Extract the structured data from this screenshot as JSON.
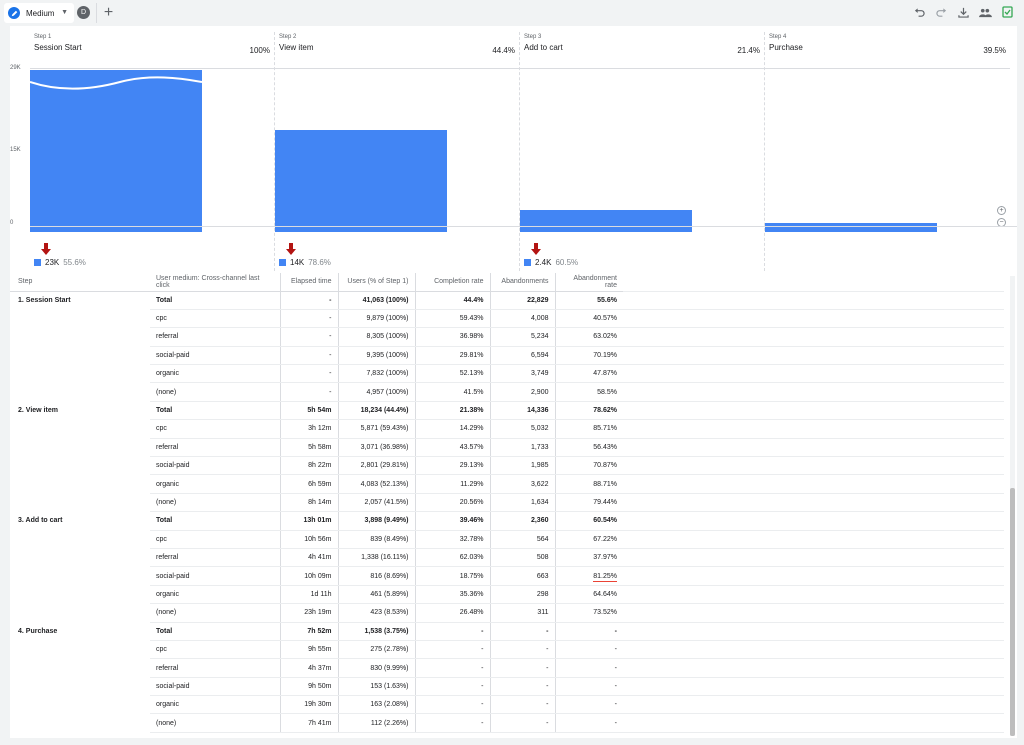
{
  "tab": {
    "label": "Medium",
    "avatar": "D",
    "add": "+"
  },
  "toolbar": {
    "icons": [
      "undo-icon",
      "redo-icon",
      "download-icon",
      "share-users-icon",
      "check-doc-icon"
    ]
  },
  "colors": {
    "bar": "#4285f4",
    "arrow": "#b31412",
    "underline": "#ea4335"
  },
  "funnel": {
    "y_ticks": [
      "29K",
      "15K",
      "0"
    ],
    "steps": [
      {
        "num": "Step 1",
        "name": "Session Start",
        "pct": "100%",
        "value": 41063,
        "abandon_value": "23K",
        "abandon_pct": "55.6%"
      },
      {
        "num": "Step 2",
        "name": "View item",
        "pct": "44.4%",
        "value": 18234,
        "abandon_value": "14K",
        "abandon_pct": "78.6%"
      },
      {
        "num": "Step 3",
        "name": "Add to cart",
        "pct": "21.4%",
        "value": 3898,
        "abandon_value": "2.4K",
        "abandon_pct": "60.5%"
      },
      {
        "num": "Step 4",
        "name": "Purchase",
        "pct": "39.5%",
        "value": 1538,
        "abandon_value": "",
        "abandon_pct": ""
      }
    ]
  },
  "table": {
    "headers": [
      "Step",
      "User medium: Cross-channel last click",
      "Elapsed time",
      "Users (% of Step 1)",
      "Completion rate",
      "Abandonments",
      "Abandonment rate"
    ],
    "rows": [
      [
        "1. Session Start",
        "Total",
        "-",
        "41,063 (100%)",
        "44.4%",
        "22,829",
        "55.6%"
      ],
      [
        "",
        "cpc",
        "-",
        "9,879 (100%)",
        "59.43%",
        "4,008",
        "40.57%"
      ],
      [
        "",
        "referral",
        "-",
        "8,305 (100%)",
        "36.98%",
        "5,234",
        "63.02%"
      ],
      [
        "",
        "social-paid",
        "-",
        "9,395 (100%)",
        "29.81%",
        "6,594",
        "70.19%"
      ],
      [
        "",
        "organic",
        "-",
        "7,832 (100%)",
        "52.13%",
        "3,749",
        "47.87%"
      ],
      [
        "",
        "(none)",
        "-",
        "4,957 (100%)",
        "41.5%",
        "2,900",
        "58.5%"
      ],
      [
        "2. View item",
        "Total",
        "5h 54m",
        "18,234 (44.4%)",
        "21.38%",
        "14,336",
        "78.62%"
      ],
      [
        "",
        "cpc",
        "3h 12m",
        "5,871 (59.43%)",
        "14.29%",
        "5,032",
        "85.71%"
      ],
      [
        "",
        "referral",
        "5h 58m",
        "3,071 (36.98%)",
        "43.57%",
        "1,733",
        "56.43%"
      ],
      [
        "",
        "social-paid",
        "8h 22m",
        "2,801 (29.81%)",
        "29.13%",
        "1,985",
        "70.87%"
      ],
      [
        "",
        "organic",
        "6h 59m",
        "4,083 (52.13%)",
        "11.29%",
        "3,622",
        "88.71%"
      ],
      [
        "",
        "(none)",
        "8h 14m",
        "2,057 (41.5%)",
        "20.56%",
        "1,634",
        "79.44%"
      ],
      [
        "3. Add to cart",
        "Total",
        "13h 01m",
        "3,898 (9.49%)",
        "39.46%",
        "2,360",
        "60.54%"
      ],
      [
        "",
        "cpc",
        "10h 56m",
        "839 (8.49%)",
        "32.78%",
        "564",
        "67.22%"
      ],
      [
        "",
        "referral",
        "4h 41m",
        "1,338 (16.11%)",
        "62.03%",
        "508",
        "37.97%"
      ],
      [
        "",
        "social-paid",
        "10h 09m",
        "816 (8.69%)",
        "18.75%",
        "663",
        "81.25%"
      ],
      [
        "",
        "organic",
        "1d 11h",
        "461 (5.89%)",
        "35.36%",
        "298",
        "64.64%"
      ],
      [
        "",
        "(none)",
        "23h 19m",
        "423 (8.53%)",
        "26.48%",
        "311",
        "73.52%"
      ],
      [
        "4. Purchase",
        "Total",
        "7h 52m",
        "1,538 (3.75%)",
        "-",
        "-",
        "-"
      ],
      [
        "",
        "cpc",
        "9h 55m",
        "275 (2.78%)",
        "-",
        "-",
        "-"
      ],
      [
        "",
        "referral",
        "4h 37m",
        "830 (9.99%)",
        "-",
        "-",
        "-"
      ],
      [
        "",
        "social-paid",
        "9h 50m",
        "153 (1.63%)",
        "-",
        "-",
        "-"
      ],
      [
        "",
        "organic",
        "19h 30m",
        "163 (2.08%)",
        "-",
        "-",
        "-"
      ],
      [
        "",
        "(none)",
        "7h 41m",
        "112 (2.26%)",
        "-",
        "-",
        "-"
      ]
    ],
    "highlighted_cell": {
      "row": 15,
      "col": 6
    }
  }
}
